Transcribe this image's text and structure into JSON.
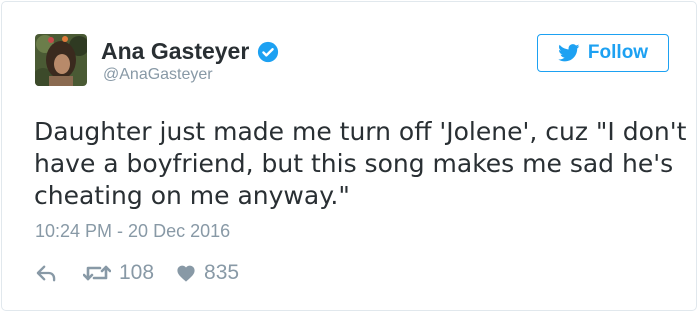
{
  "user": {
    "name": "Ana Gasteyer",
    "handle": "@AnaGasteyer",
    "verified_icon": "verified-badge-icon"
  },
  "follow_button": {
    "label": "Follow",
    "icon": "twitter-bird-icon"
  },
  "tweet": {
    "lines": [
      "Daughter just made me turn off 'Jolene', cuz \"I don't",
      "have a boyfriend, but this song makes me sad he's",
      "cheating on me anyway.\""
    ],
    "timestamp": "10:24 PM - 20 Dec 2016"
  },
  "actions": {
    "reply_icon": "reply-icon",
    "retweet_icon": "retweet-icon",
    "retweet_count": "108",
    "like_icon": "heart-icon",
    "like_count": "835"
  },
  "colors": {
    "accent": "#1da1f2",
    "text": "#292f33",
    "muted": "#8899a6",
    "border": "#e1e8ed"
  }
}
